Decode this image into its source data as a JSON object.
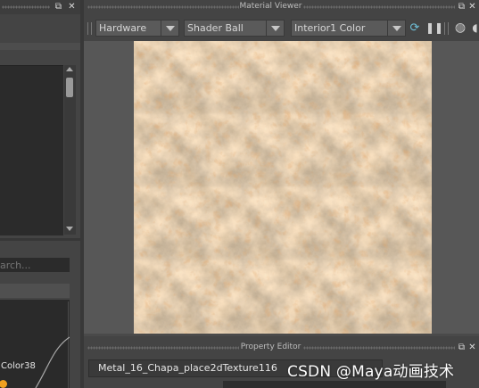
{
  "material_viewer": {
    "title": "Material Viewer",
    "renderer": "Hardware",
    "shape": "Shader Ball",
    "environment": "Interior1 Color"
  },
  "property_editor": {
    "title": "Property Editor",
    "node_name": "Metal_16_Chapa_place2dTexture116"
  },
  "left_panel": {
    "search_placeholder": "arch...",
    "node_label": "Color38"
  },
  "colors": {
    "port": "#f0a020",
    "texture_base": "#9a8060"
  },
  "watermark": "CSDN @Maya动画技术"
}
